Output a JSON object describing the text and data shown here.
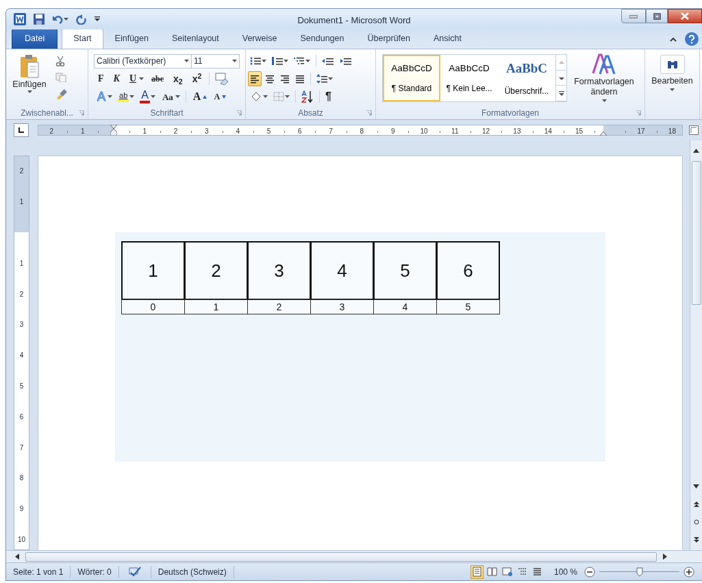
{
  "window": {
    "title": "Dokument1 - Microsoft Word"
  },
  "tabs": [
    {
      "label": "Datei",
      "kind": "file",
      "selected": false
    },
    {
      "label": "Start",
      "kind": "tab",
      "selected": true
    },
    {
      "label": "Einfügen",
      "kind": "tab",
      "selected": false
    },
    {
      "label": "Seitenlayout",
      "kind": "tab",
      "selected": false
    },
    {
      "label": "Verweise",
      "kind": "tab",
      "selected": false
    },
    {
      "label": "Sendungen",
      "kind": "tab",
      "selected": false
    },
    {
      "label": "Überprüfen",
      "kind": "tab",
      "selected": false
    },
    {
      "label": "Ansicht",
      "kind": "tab",
      "selected": false
    }
  ],
  "ribbon": {
    "clipboard": {
      "paste_label": "Einfügen",
      "group_label": "Zwischenabl..."
    },
    "font": {
      "font_name": "Calibri (Textkörper)",
      "font_size": "11",
      "group_label": "Schriftart",
      "format_buttons": [
        {
          "text": "F",
          "kind": "bold"
        },
        {
          "text": "K",
          "kind": "italic"
        },
        {
          "text": "U",
          "kind": "underline"
        },
        {
          "text": "abc",
          "kind": "strike"
        },
        {
          "text": "x$_{2}$",
          "kind": "sub"
        },
        {
          "text": "x$^{2}$",
          "kind": "sup"
        }
      ],
      "effect_buttons": [
        {
          "text": "A",
          "kind": "effect"
        },
        {
          "text": "ab",
          "kind": "highlight"
        },
        {
          "text": "A",
          "kind": "color"
        },
        {
          "text": "Aa",
          "kind": "case"
        },
        {
          "text": "A",
          "kind": "grow"
        },
        {
          "text": "A",
          "kind": "shrink"
        }
      ]
    },
    "paragraph": {
      "group_label": "Absatz",
      "pilcrow": "¶",
      "alignments": [
        {
          "kind": "left",
          "selected": true
        },
        {
          "kind": "center",
          "selected": false
        },
        {
          "kind": "right",
          "selected": false
        },
        {
          "kind": "justify",
          "selected": false
        }
      ]
    },
    "styles": {
      "group_label": "Formatvorlagen",
      "change_label": "Formatvorlagen ändern",
      "items": [
        {
          "sample": "AaBbCcD",
          "name": "¶ Standard",
          "kind": "normal",
          "selected": true
        },
        {
          "sample": "AaBbCcD",
          "name": "¶ Kein Lee...",
          "kind": "normal",
          "selected": false
        },
        {
          "sample": "AaBbC",
          "name": "Überschrif...",
          "kind": "heading",
          "selected": false
        }
      ]
    },
    "editing": {
      "label": "Bearbeiten"
    }
  },
  "ruler": {
    "horizontal": [
      "2",
      "1",
      "1",
      "2",
      "3",
      "4",
      "5",
      "6",
      "7",
      "8",
      "9",
      "10",
      "11",
      "12",
      "13",
      "14",
      "15",
      "17",
      "18"
    ],
    "vertical": [
      "2",
      "1",
      "1",
      "2",
      "3",
      "4",
      "5",
      "6",
      "7",
      "8",
      "9",
      "10"
    ]
  },
  "document": {
    "table": {
      "rows": [
        [
          "1",
          "2",
          "3",
          "4",
          "5",
          "6"
        ],
        [
          "0",
          "1",
          "2",
          "3",
          "4",
          "5"
        ]
      ]
    }
  },
  "status_bar": {
    "page": "Seite: 1 von 1",
    "words": "Wörter: 0",
    "language": "Deutsch (Schweiz)",
    "views": [
      {
        "kind": "print",
        "selected": true
      },
      {
        "kind": "read",
        "selected": false
      },
      {
        "kind": "web",
        "selected": false
      },
      {
        "kind": "outline",
        "selected": false
      },
      {
        "kind": "draft",
        "selected": false
      }
    ],
    "zoom": "100 %",
    "zoom_slider": {
      "level": 0.5
    }
  }
}
